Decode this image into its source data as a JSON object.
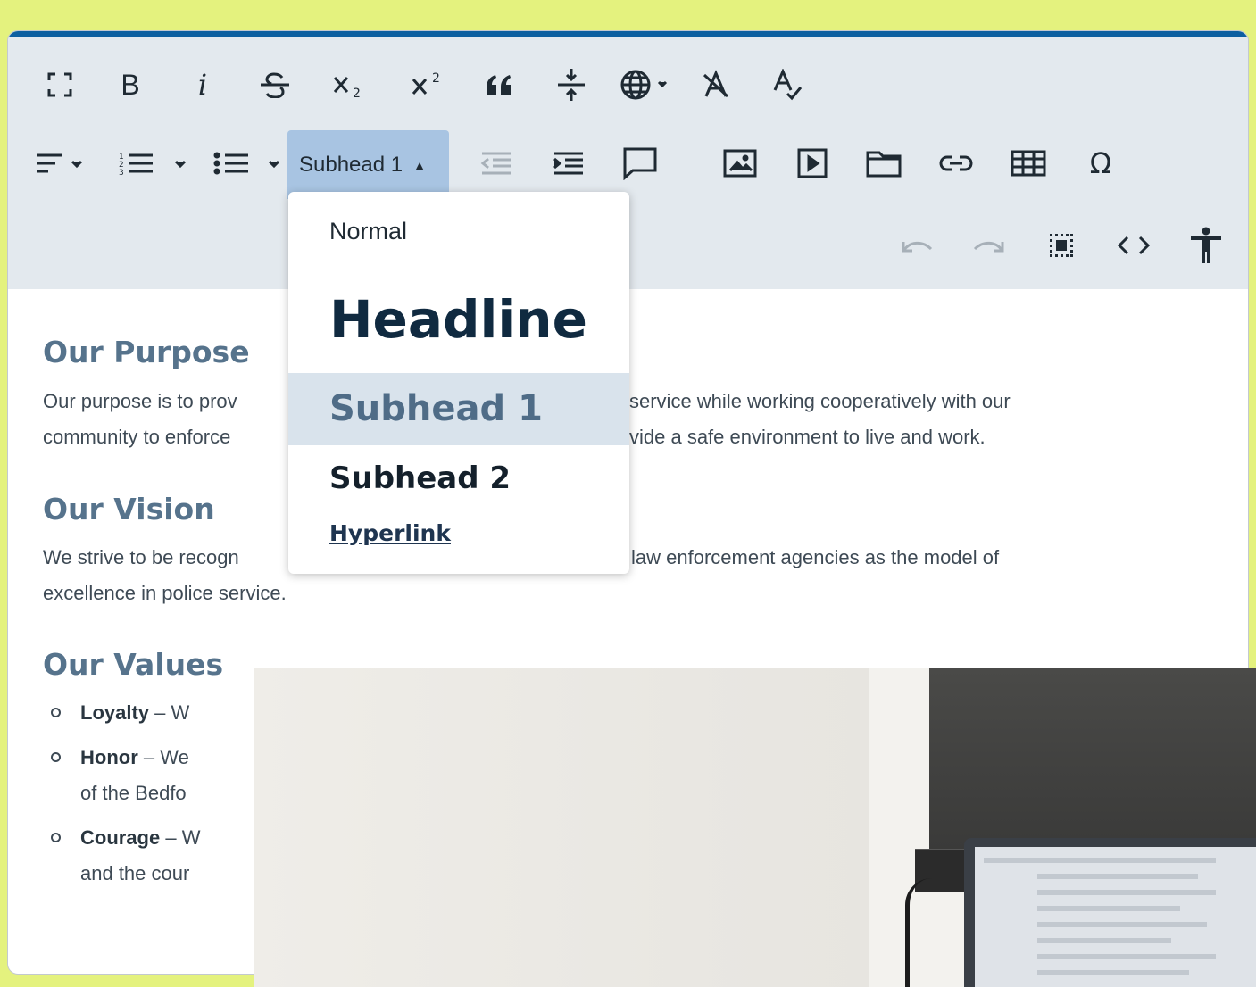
{
  "toolbar": {
    "row1": [
      {
        "name": "fullscreen-icon"
      },
      {
        "name": "bold-button",
        "label": "B"
      },
      {
        "name": "italic-button",
        "label": "i"
      },
      {
        "name": "strikethrough-button"
      },
      {
        "name": "subscript-button"
      },
      {
        "name": "superscript-button"
      },
      {
        "name": "blockquote-button",
        "label": "66"
      },
      {
        "name": "horizontal-rule-button"
      },
      {
        "name": "language-button"
      },
      {
        "name": "clear-formatting-button"
      },
      {
        "name": "spellcheck-button"
      }
    ],
    "style_select": {
      "value": "Subhead 1"
    }
  },
  "dropdown": {
    "options": [
      "Normal",
      "Headline",
      "Subhead 1",
      "Subhead 2",
      "Hyperlink"
    ],
    "selected": "Subhead 1"
  },
  "content": {
    "sections": [
      {
        "heading": "Our Purpose",
        "line1_left": "Our purpose is to prov",
        "line1_right": "service while working cooperatively with our",
        "line2_left": "community to enforce",
        "line2_right": "vide a safe environment to live and work."
      },
      {
        "heading": "Our Vision",
        "line1_left": "We strive to be recogn",
        "line1_right": "law enforcement agencies as the model of",
        "line2_left": "excellence in police service."
      },
      {
        "heading": "Our Values",
        "items": [
          {
            "term": "Loyalty",
            "rest": " – W"
          },
          {
            "term": "Honor",
            "rest": " – We",
            "line2": "of the Bedfo"
          },
          {
            "term": "Courage",
            "rest": " – W",
            "line2": "and the cour"
          }
        ]
      }
    ]
  },
  "colors": {
    "page_bg": "#e4f27e",
    "toolbar_bg": "#e3e9ee",
    "accent": "#0c5fa0",
    "heading": "#56738c",
    "selected_option_bg": "#d9e3ec"
  }
}
